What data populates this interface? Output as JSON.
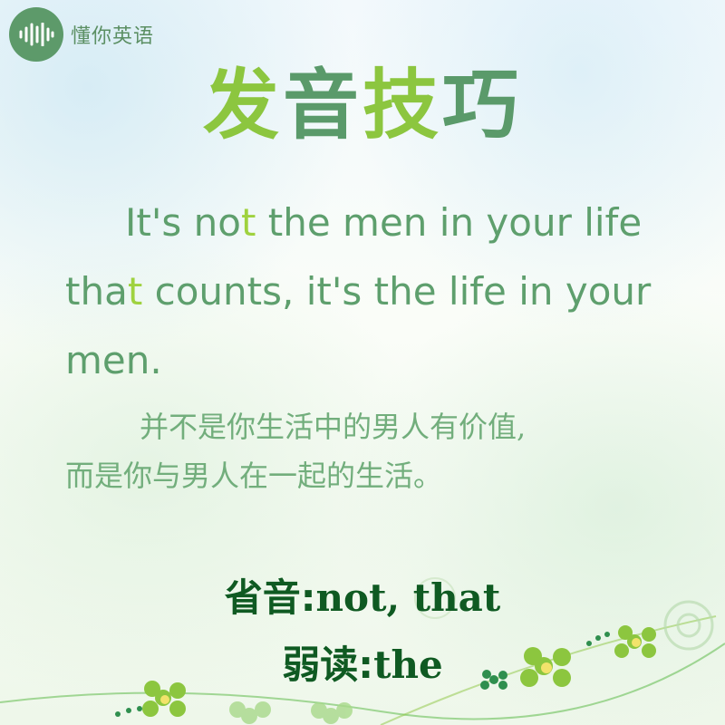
{
  "brand": {
    "name": "懂你英语",
    "logo_icon": "sound-wave-icon",
    "accent": "#5d9a6a"
  },
  "title": {
    "part1": "发",
    "part2": "音",
    "part3": "技",
    "part4": "巧"
  },
  "sentence": {
    "line1_a": "It's no",
    "line1_hl": "t",
    "line1_b": " the men in your life",
    "line2_a": "tha",
    "line2_hl": "t",
    "line2_b": " counts, it's the life in your",
    "line3": "men."
  },
  "translation": {
    "line1": "并不是你生活中的男人有价值,",
    "line2": "而是你与男人在一起的生活。"
  },
  "rules": {
    "elision_label": "省音:",
    "elision_words": "not, that",
    "weak_label": "弱读:",
    "weak_words": "the"
  },
  "colors": {
    "title_light": "#8cc63f",
    "title_dark": "#5a9a6a",
    "highlight": "#9fd23f",
    "rule_text": "#0f5a22"
  }
}
